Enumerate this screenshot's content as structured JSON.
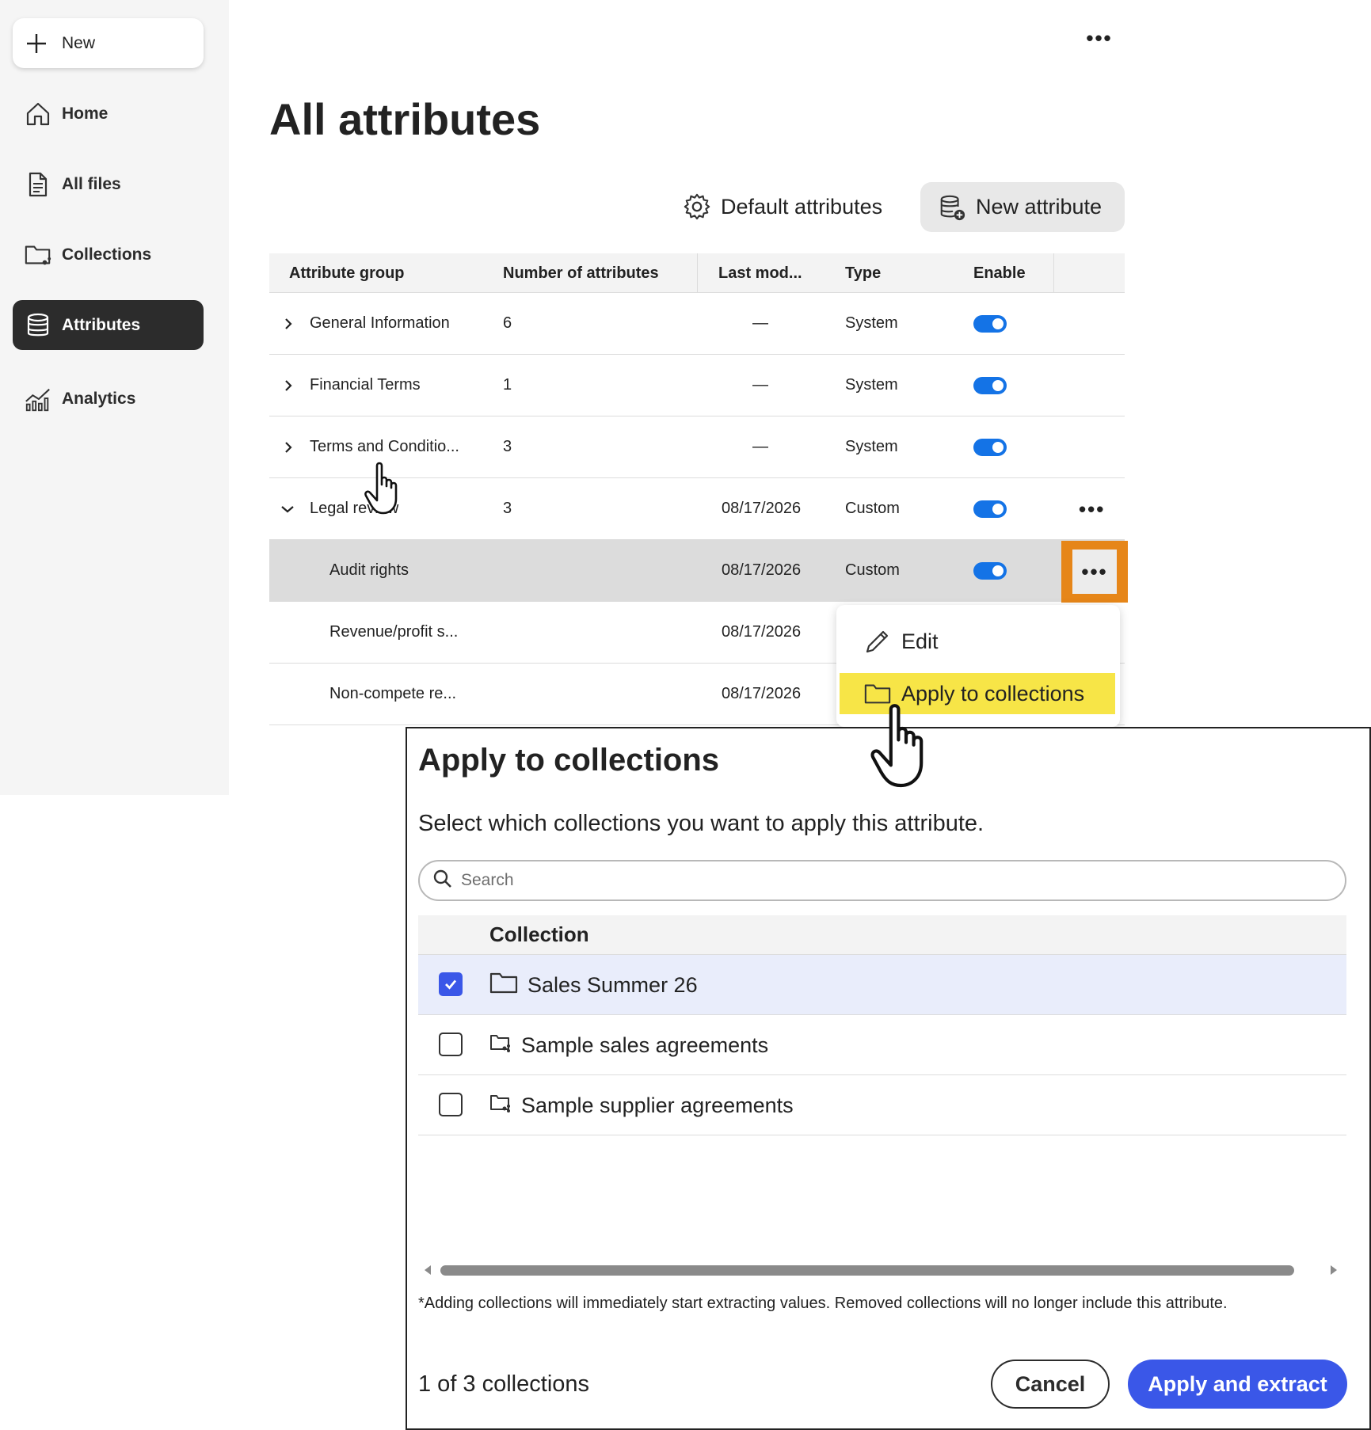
{
  "sidebar": {
    "new_label": "New",
    "items": [
      {
        "label": "Home",
        "icon": "home-icon"
      },
      {
        "label": "All files",
        "icon": "file-icon"
      },
      {
        "label": "Collections",
        "icon": "collections-icon"
      },
      {
        "label": "Attributes",
        "icon": "database-icon",
        "active": true
      },
      {
        "label": "Analytics",
        "icon": "analytics-icon"
      }
    ]
  },
  "main": {
    "title": "All attributes",
    "default_attributes_label": "Default attributes",
    "new_attribute_label": "New attribute"
  },
  "table": {
    "headers": [
      "Attribute group",
      "Number of attributes",
      "Last mod...",
      "Type",
      "Enable"
    ],
    "rows": [
      {
        "name": "General Information",
        "count": "6",
        "modified": "—",
        "type": "System",
        "enabled": true,
        "expander": "collapsed"
      },
      {
        "name": "Financial Terms",
        "count": "1",
        "modified": "—",
        "type": "System",
        "enabled": true,
        "expander": "collapsed"
      },
      {
        "name": "Terms and Conditio...",
        "count": "3",
        "modified": "—",
        "type": "System",
        "enabled": true,
        "expander": "collapsed"
      },
      {
        "name": "Legal review",
        "count": "3",
        "modified": "08/17/2026",
        "type": "Custom",
        "enabled": true,
        "expander": "expanded"
      },
      {
        "name": "Audit rights",
        "count": "",
        "modified": "08/17/2026",
        "type": "Custom",
        "enabled": true,
        "child": true,
        "highlighted": true
      },
      {
        "name": "Revenue/profit s...",
        "count": "",
        "modified": "08/17/2026",
        "type": "",
        "child": true
      },
      {
        "name": "Non-compete re...",
        "count": "",
        "modified": "08/17/2026",
        "type": "",
        "child": true
      }
    ]
  },
  "context_menu": {
    "items": [
      {
        "label": "Edit",
        "icon": "pencil-icon"
      },
      {
        "label": "Apply to collections",
        "icon": "folder-icon",
        "highlighted": true
      }
    ]
  },
  "dialog": {
    "title": "Apply to collections",
    "description": "Select which collections you want to apply this attribute.",
    "search_placeholder": "Search",
    "column_header": "Collection",
    "collections": [
      {
        "name": "Sales Summer 26",
        "checked": true,
        "icon": "folder-icon"
      },
      {
        "name": "Sample sales agreements",
        "checked": false,
        "icon": "shared-folder-icon"
      },
      {
        "name": "Sample supplier agreements",
        "checked": false,
        "icon": "shared-folder-icon"
      }
    ],
    "note": "*Adding collections will immediately start extracting values. Removed collections will no longer include this attribute.",
    "count_text": "1 of 3 collections",
    "cancel_label": "Cancel",
    "apply_label": "Apply and extract"
  },
  "colors": {
    "accent": "#1473e6",
    "primary_button": "#3a57e8",
    "menu_highlight": "#f7e547",
    "focus_outline": "#e68619"
  }
}
